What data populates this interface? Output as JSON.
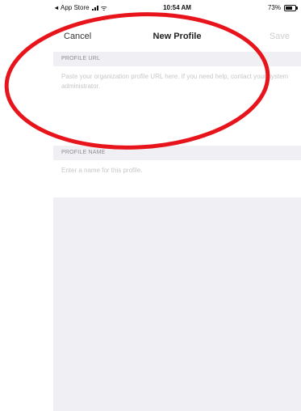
{
  "status_bar": {
    "carrier": "App Store",
    "time": "10:54 AM",
    "battery_percent": "73%",
    "battery_level": 0.73
  },
  "nav": {
    "cancel_label": "Cancel",
    "title": "New Profile",
    "save_label": "Save"
  },
  "sections": {
    "profile_url": {
      "header": "PROFILE URL",
      "placeholder": "Paste your organization profile URL here. If you need help, contact your system administrator."
    },
    "profile_name": {
      "header": "PROFILE NAME",
      "placeholder": "Enter a name for this profile."
    }
  },
  "colors": {
    "annotation": "#e8141b",
    "section_bg": "#efeff4",
    "placeholder": "#c7c7cc",
    "save_disabled": "#cfcfcf"
  }
}
